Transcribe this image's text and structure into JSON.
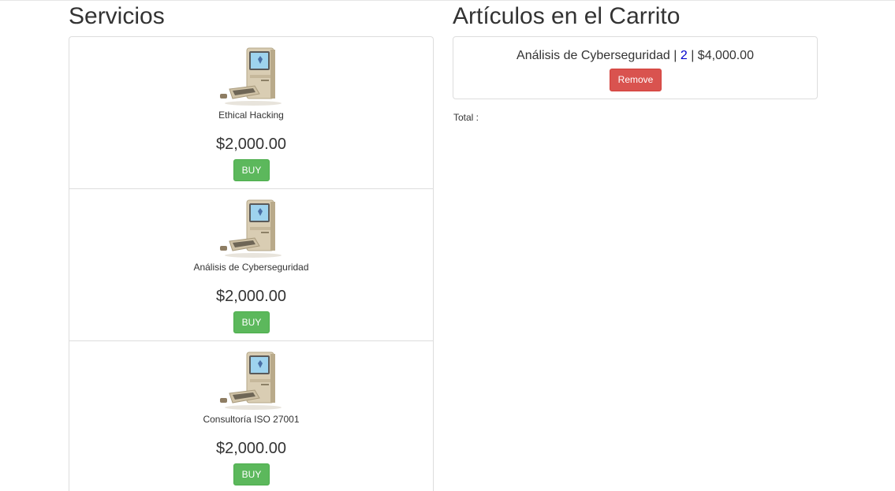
{
  "services": {
    "title": "Servicios",
    "items": [
      {
        "name": "Ethical Hacking",
        "price": "$2,000.00",
        "buy_label": "BUY",
        "image_icon": "vintage-computer-icon"
      },
      {
        "name": "Análisis de Cyberseguridad",
        "price": "$2,000.00",
        "buy_label": "BUY",
        "image_icon": "vintage-computer-icon"
      },
      {
        "name": "Consultoría ISO 27001",
        "price": "$2,000.00",
        "buy_label": "BUY",
        "image_icon": "vintage-computer-icon"
      }
    ]
  },
  "cart": {
    "title": "Artículos en el Carrito",
    "items": [
      {
        "name": "Análisis de Cyberseguridad",
        "separator": " | ",
        "quantity": "2",
        "subtotal": "$4,000.00",
        "remove_label": "Remove"
      }
    ],
    "total_label": "Total :"
  },
  "colors": {
    "buy_button": "#5cb85c",
    "remove_button": "#d9534f",
    "quantity_link": "#0000cc",
    "border": "#dddddd"
  }
}
